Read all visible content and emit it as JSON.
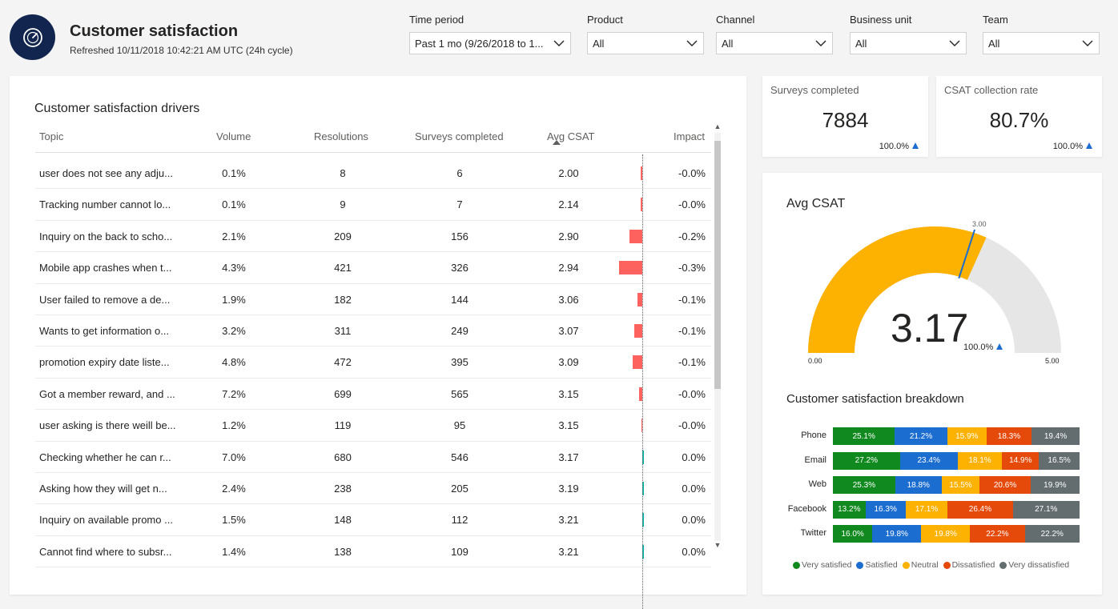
{
  "header": {
    "title": "Customer satisfaction",
    "refreshed": "Refreshed 10/11/2018 10:42:21 AM UTC (24h cycle)"
  },
  "filters": [
    {
      "label": "Time period",
      "value": "Past 1 mo (9/26/2018 to 1..."
    },
    {
      "label": "Product",
      "value": "All"
    },
    {
      "label": "Channel",
      "value": "All"
    },
    {
      "label": "Business unit",
      "value": "All"
    },
    {
      "label": "Team",
      "value": "All"
    }
  ],
  "drivers": {
    "title": "Customer satisfaction drivers",
    "columns": [
      "Topic",
      "Volume",
      "Resolutions",
      "Surveys completed",
      "Avg CSAT",
      "Impact"
    ],
    "rows": [
      {
        "topic": "user does not see any adju...",
        "volume": "0.1%",
        "resolutions": "8",
        "surveys": "6",
        "avg": "2.00",
        "impact": "-0.0%",
        "impact_value": -0.02
      },
      {
        "topic": "Tracking number cannot lo...",
        "volume": "0.1%",
        "resolutions": "9",
        "surveys": "7",
        "avg": "2.14",
        "impact": "-0.0%",
        "impact_value": -0.02
      },
      {
        "topic": "Inquiry on the back to scho...",
        "volume": "2.1%",
        "resolutions": "209",
        "surveys": "156",
        "avg": "2.90",
        "impact": "-0.2%",
        "impact_value": -0.16
      },
      {
        "topic": "Mobile app crashes when t...",
        "volume": "4.3%",
        "resolutions": "421",
        "surveys": "326",
        "avg": "2.94",
        "impact": "-0.3%",
        "impact_value": -0.29
      },
      {
        "topic": "User failed to remove a de...",
        "volume": "1.9%",
        "resolutions": "182",
        "surveys": "144",
        "avg": "3.06",
        "impact": "-0.1%",
        "impact_value": -0.06
      },
      {
        "topic": "Wants to get information o...",
        "volume": "3.2%",
        "resolutions": "311",
        "surveys": "249",
        "avg": "3.07",
        "impact": "-0.1%",
        "impact_value": -0.1
      },
      {
        "topic": "promotion expiry date liste...",
        "volume": "4.8%",
        "resolutions": "472",
        "surveys": "395",
        "avg": "3.09",
        "impact": "-0.1%",
        "impact_value": -0.12
      },
      {
        "topic": "Got a member reward, and ...",
        "volume": "7.2%",
        "resolutions": "699",
        "surveys": "565",
        "avg": "3.15",
        "impact": "-0.0%",
        "impact_value": -0.04
      },
      {
        "topic": "user asking is there weill be...",
        "volume": "1.2%",
        "resolutions": "119",
        "surveys": "95",
        "avg": "3.15",
        "impact": "-0.0%",
        "impact_value": -0.01
      },
      {
        "topic": "Checking whether he can r...",
        "volume": "7.0%",
        "resolutions": "680",
        "surveys": "546",
        "avg": "3.17",
        "impact": "0.0%",
        "impact_value": 0.01
      },
      {
        "topic": "Asking how they will get n...",
        "volume": "2.4%",
        "resolutions": "238",
        "surveys": "205",
        "avg": "3.19",
        "impact": "0.0%",
        "impact_value": 0.01
      },
      {
        "topic": "Inquiry on available promo ...",
        "volume": "1.5%",
        "resolutions": "148",
        "surveys": "112",
        "avg": "3.21",
        "impact": "0.0%",
        "impact_value": 0.01
      },
      {
        "topic": "Cannot find where to subsr...",
        "volume": "1.4%",
        "resolutions": "138",
        "surveys": "109",
        "avg": "3.21",
        "impact": "0.0%",
        "impact_value": 0.01
      }
    ]
  },
  "kpis": [
    {
      "label": "Surveys completed",
      "value": "7884",
      "delta": "100.0%"
    },
    {
      "label": "CSAT collection rate",
      "value": "80.7%",
      "delta": "100.0%"
    }
  ],
  "gauge": {
    "title": "Avg CSAT",
    "value": 3.17,
    "value_text": "3.17",
    "delta": "100.0%",
    "min": 0,
    "max": 5,
    "min_text": "0.00",
    "max_text": "5.00",
    "target": 3,
    "target_text": "3.00"
  },
  "breakdown": {
    "title": "Customer satisfaction breakdown",
    "legend": [
      "Very satisfied",
      "Satisfied",
      "Neutral",
      "Dissatisfied",
      "Very dissatisfied"
    ],
    "colors": [
      "#10891e",
      "#1c6dd0",
      "#fdb100",
      "#e54a0a",
      "#636c6f"
    ],
    "rows": [
      {
        "label": "Phone",
        "values": [
          25.1,
          21.2,
          15.9,
          18.3,
          19.4
        ]
      },
      {
        "label": "Email",
        "values": [
          27.2,
          23.4,
          18.1,
          14.9,
          16.5
        ]
      },
      {
        "label": "Web",
        "values": [
          25.3,
          18.8,
          15.5,
          20.6,
          19.9
        ]
      },
      {
        "label": "Facebook",
        "values": [
          13.2,
          16.3,
          17.1,
          26.4,
          27.1
        ]
      },
      {
        "label": "Twitter",
        "values": [
          16.0,
          19.8,
          19.8,
          22.2,
          22.2
        ]
      }
    ]
  },
  "colors": {
    "negative_impact": "#fd625e",
    "positive_impact": "#01b8aa",
    "gauge_fill": "#fdb100",
    "gauge_track": "#e6e6e6",
    "gauge_target": "#1c6dd0",
    "logo_bg": "#11254f"
  }
}
